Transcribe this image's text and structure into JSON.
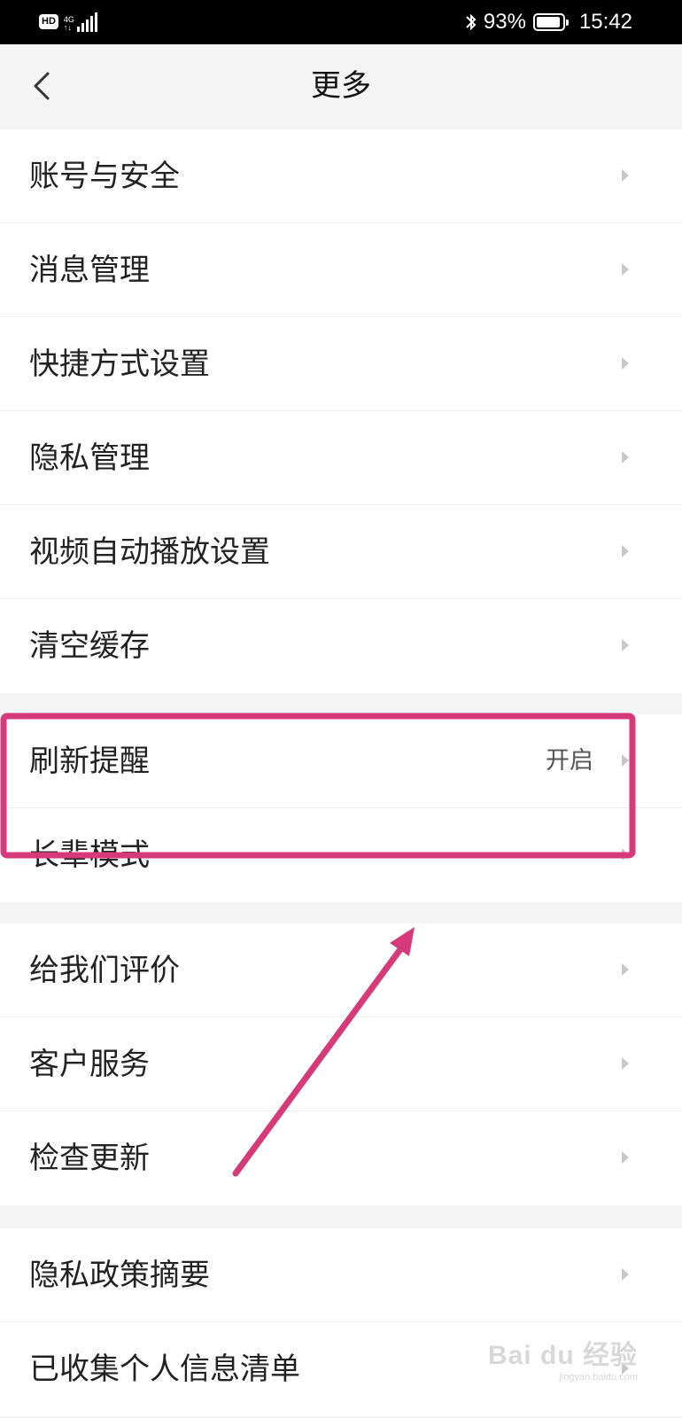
{
  "status_bar": {
    "hd": "HD",
    "network": "4G",
    "network_sub": "↑↓",
    "battery_text": "93%",
    "battery_level": 0.93,
    "time": "15:42",
    "icons": [
      "bluetooth-icon",
      "signal-icon",
      "battery-icon"
    ]
  },
  "header": {
    "title": "更多",
    "back_icon": "chevron-left-icon"
  },
  "groups": [
    {
      "items": [
        {
          "label": "账号与安全"
        },
        {
          "label": "消息管理"
        },
        {
          "label": "快捷方式设置"
        },
        {
          "label": "隐私管理"
        },
        {
          "label": "视频自动播放设置"
        },
        {
          "label": "清空缓存"
        }
      ]
    },
    {
      "items": [
        {
          "label": "刷新提醒",
          "value": "开启"
        },
        {
          "label": "长辈模式"
        }
      ]
    },
    {
      "items": [
        {
          "label": "给我们评价"
        },
        {
          "label": "客户服务"
        },
        {
          "label": "检查更新"
        }
      ]
    },
    {
      "items": [
        {
          "label": "隐私政策摘要"
        },
        {
          "label": "已收集个人信息清单"
        }
      ]
    }
  ],
  "annotation": {
    "color": "#d63a7a"
  },
  "watermark": {
    "text": "Bai du 经验",
    "sub": "jingyan.baidu.com"
  }
}
